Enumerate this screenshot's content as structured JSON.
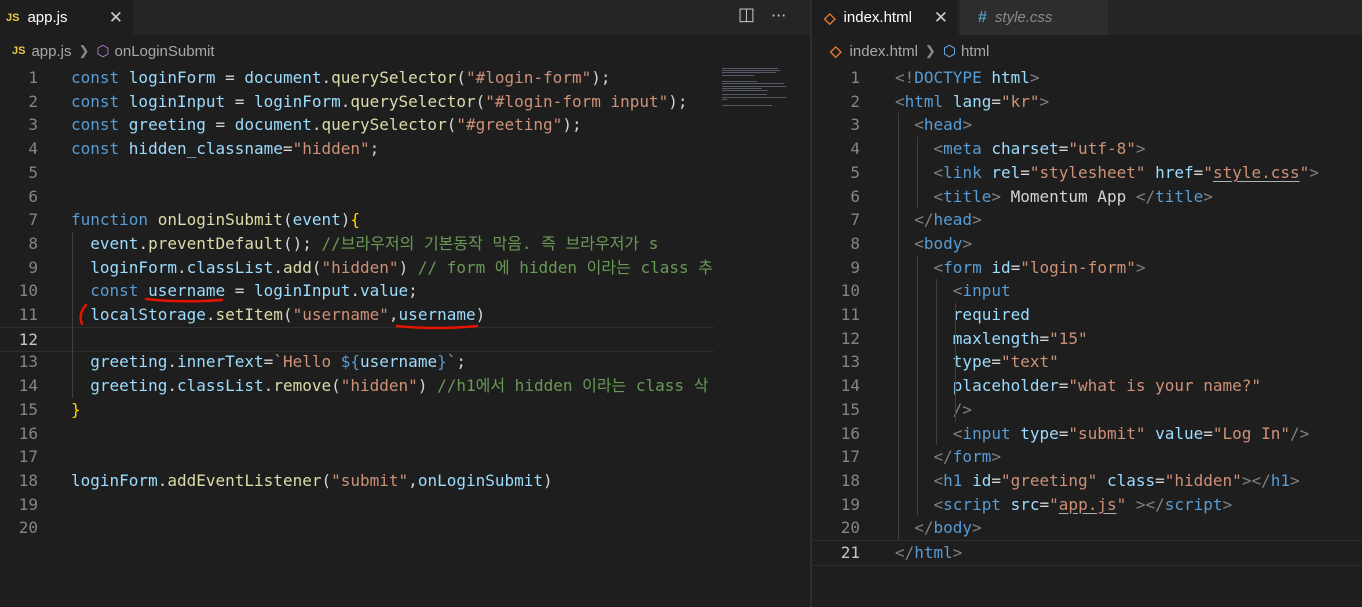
{
  "left": {
    "tab": {
      "icon": "JS",
      "label": "app.js",
      "close": "✕"
    },
    "actions": {
      "split": "◫",
      "more": "···"
    },
    "breadcrumb": {
      "file": "app.js",
      "symbol": "onLoginSubmit"
    },
    "lines": [
      {
        "n": "1",
        "t": [
          [
            "k",
            "const "
          ],
          [
            "v",
            "loginForm"
          ],
          [
            "p",
            " = "
          ],
          [
            "v",
            "document"
          ],
          [
            "p",
            "."
          ],
          [
            "f",
            "querySelector"
          ],
          [
            "p",
            "("
          ],
          [
            "s",
            "\"#login-form\""
          ],
          [
            "p",
            ");"
          ]
        ]
      },
      {
        "n": "2",
        "t": [
          [
            "k",
            "const "
          ],
          [
            "v",
            "loginInput"
          ],
          [
            "p",
            " = "
          ],
          [
            "v",
            "loginForm"
          ],
          [
            "p",
            "."
          ],
          [
            "f",
            "querySelector"
          ],
          [
            "p",
            "("
          ],
          [
            "s",
            "\"#login-form input\""
          ],
          [
            "p",
            ");"
          ]
        ]
      },
      {
        "n": "3",
        "t": [
          [
            "k",
            "const "
          ],
          [
            "v",
            "greeting"
          ],
          [
            "p",
            " = "
          ],
          [
            "v",
            "document"
          ],
          [
            "p",
            "."
          ],
          [
            "f",
            "querySelector"
          ],
          [
            "p",
            "("
          ],
          [
            "s",
            "\"#greeting\""
          ],
          [
            "p",
            ");"
          ]
        ]
      },
      {
        "n": "4",
        "t": [
          [
            "k",
            "const "
          ],
          [
            "v",
            "hidden_classname"
          ],
          [
            "p",
            "="
          ],
          [
            "s",
            "\"hidden\""
          ],
          [
            "p",
            ";"
          ]
        ]
      },
      {
        "n": "5",
        "t": []
      },
      {
        "n": "6",
        "t": []
      },
      {
        "n": "7",
        "t": [
          [
            "k",
            "function "
          ],
          [
            "f",
            "onLoginSubmit"
          ],
          [
            "p",
            "("
          ],
          [
            "v",
            "event"
          ],
          [
            "p",
            ")"
          ],
          [
            "b",
            "{"
          ]
        ]
      },
      {
        "n": "8",
        "t": [
          [
            "p",
            "  "
          ],
          [
            "v",
            "event"
          ],
          [
            "p",
            "."
          ],
          [
            "f",
            "preventDefault"
          ],
          [
            "p",
            "(); "
          ],
          [
            "c",
            "//브라우저의 기본동작 막음. 즉 브라우저가 s"
          ]
        ]
      },
      {
        "n": "9",
        "t": [
          [
            "p",
            "  "
          ],
          [
            "v",
            "loginForm"
          ],
          [
            "p",
            "."
          ],
          [
            "v",
            "classList"
          ],
          [
            "p",
            "."
          ],
          [
            "f",
            "add"
          ],
          [
            "p",
            "("
          ],
          [
            "s",
            "\"hidden\""
          ],
          [
            "p",
            ") "
          ],
          [
            "c",
            "// form 에 hidden 이라는 class 추"
          ]
        ]
      },
      {
        "n": "10",
        "t": [
          [
            "p",
            "  "
          ],
          [
            "k",
            "const "
          ],
          [
            "v",
            "username"
          ],
          [
            "p",
            " = "
          ],
          [
            "v",
            "loginInput"
          ],
          [
            "p",
            "."
          ],
          [
            "v",
            "value"
          ],
          [
            "p",
            ";"
          ]
        ]
      },
      {
        "n": "11",
        "t": [
          [
            "p",
            "  "
          ],
          [
            "v",
            "localStorage"
          ],
          [
            "p",
            "."
          ],
          [
            "f",
            "setItem"
          ],
          [
            "p",
            "("
          ],
          [
            "s",
            "\"username\""
          ],
          [
            "p",
            ","
          ],
          [
            "v",
            "username"
          ],
          [
            "p",
            ")"
          ]
        ]
      },
      {
        "n": "12",
        "t": []
      },
      {
        "n": "13",
        "t": [
          [
            "p",
            "  "
          ],
          [
            "v",
            "greeting"
          ],
          [
            "p",
            "."
          ],
          [
            "v",
            "innerText"
          ],
          [
            "p",
            "="
          ],
          [
            "s",
            "`Hello "
          ],
          [
            "k",
            "${"
          ],
          [
            "v",
            "username"
          ],
          [
            "k",
            "}"
          ],
          [
            "s",
            "`"
          ],
          [
            "p",
            ";"
          ]
        ]
      },
      {
        "n": "14",
        "t": [
          [
            "p",
            "  "
          ],
          [
            "v",
            "greeting"
          ],
          [
            "p",
            "."
          ],
          [
            "v",
            "classList"
          ],
          [
            "p",
            "."
          ],
          [
            "f",
            "remove"
          ],
          [
            "p",
            "("
          ],
          [
            "s",
            "\"hidden\""
          ],
          [
            "p",
            ") "
          ],
          [
            "c",
            "//h1에서 hidden 이라는 class 삭"
          ]
        ]
      },
      {
        "n": "15",
        "t": [
          [
            "b",
            "}"
          ]
        ]
      },
      {
        "n": "16",
        "t": []
      },
      {
        "n": "17",
        "t": []
      },
      {
        "n": "18",
        "t": [
          [
            "v",
            "loginForm"
          ],
          [
            "p",
            "."
          ],
          [
            "f",
            "addEventListener"
          ],
          [
            "p",
            "("
          ],
          [
            "s",
            "\"submit\""
          ],
          [
            "p",
            ","
          ],
          [
            "v",
            "onLoginSubmit"
          ],
          [
            "p",
            ")"
          ]
        ]
      },
      {
        "n": "19",
        "t": []
      },
      {
        "n": "20",
        "t": []
      }
    ]
  },
  "right": {
    "tabs": [
      {
        "icon": "◇",
        "label": "index.html",
        "close": "✕"
      },
      {
        "icon": "#",
        "label": "style.css"
      }
    ],
    "breadcrumb": {
      "file": "index.html",
      "symbol": "html"
    },
    "lines": [
      {
        "n": "1",
        "t": [
          [
            "g",
            "<!"
          ],
          [
            "t",
            "DOCTYPE "
          ],
          [
            "a",
            "html"
          ],
          [
            "g",
            ">"
          ]
        ]
      },
      {
        "n": "2",
        "t": [
          [
            "g",
            "<"
          ],
          [
            "t",
            "html "
          ],
          [
            "a",
            "lang"
          ],
          [
            "p",
            "="
          ],
          [
            "s",
            "\"kr\""
          ],
          [
            "g",
            ">"
          ]
        ]
      },
      {
        "n": "3",
        "t": [
          [
            "p",
            "  "
          ],
          [
            "g",
            "<"
          ],
          [
            "t",
            "head"
          ],
          [
            "g",
            ">"
          ]
        ]
      },
      {
        "n": "4",
        "t": [
          [
            "p",
            "    "
          ],
          [
            "g",
            "<"
          ],
          [
            "t",
            "meta "
          ],
          [
            "a",
            "charset"
          ],
          [
            "p",
            "="
          ],
          [
            "s",
            "\"utf-8\""
          ],
          [
            "g",
            ">"
          ]
        ]
      },
      {
        "n": "5",
        "t": [
          [
            "p",
            "    "
          ],
          [
            "g",
            "<"
          ],
          [
            "t",
            "link "
          ],
          [
            "a",
            "rel"
          ],
          [
            "p",
            "="
          ],
          [
            "s",
            "\"stylesheet\""
          ],
          [
            "a",
            " href"
          ],
          [
            "p",
            "="
          ],
          [
            "s",
            "\""
          ],
          [
            "su",
            "style.css"
          ],
          [
            "s",
            "\""
          ],
          [
            "g",
            ">"
          ]
        ]
      },
      {
        "n": "6",
        "t": [
          [
            "p",
            "    "
          ],
          [
            "g",
            "<"
          ],
          [
            "t",
            "title"
          ],
          [
            "g",
            "> "
          ],
          [
            "p",
            "Momentum App "
          ],
          [
            "g",
            "</"
          ],
          [
            "t",
            "title"
          ],
          [
            "g",
            ">"
          ]
        ]
      },
      {
        "n": "7",
        "t": [
          [
            "p",
            "  "
          ],
          [
            "g",
            "</"
          ],
          [
            "t",
            "head"
          ],
          [
            "g",
            ">"
          ]
        ]
      },
      {
        "n": "8",
        "t": [
          [
            "p",
            "  "
          ],
          [
            "g",
            "<"
          ],
          [
            "t",
            "body"
          ],
          [
            "g",
            ">"
          ]
        ]
      },
      {
        "n": "9",
        "t": [
          [
            "p",
            "    "
          ],
          [
            "g",
            "<"
          ],
          [
            "t",
            "form "
          ],
          [
            "a",
            "id"
          ],
          [
            "p",
            "="
          ],
          [
            "s",
            "\"login-form\""
          ],
          [
            "g",
            ">"
          ]
        ]
      },
      {
        "n": "10",
        "t": [
          [
            "p",
            "      "
          ],
          [
            "g",
            "<"
          ],
          [
            "t",
            "input"
          ]
        ]
      },
      {
        "n": "11",
        "t": [
          [
            "p",
            "      "
          ],
          [
            "a",
            "required"
          ]
        ]
      },
      {
        "n": "12",
        "t": [
          [
            "p",
            "      "
          ],
          [
            "a",
            "maxlength"
          ],
          [
            "p",
            "="
          ],
          [
            "s",
            "\"15\""
          ]
        ]
      },
      {
        "n": "13",
        "t": [
          [
            "p",
            "      "
          ],
          [
            "a",
            "type"
          ],
          [
            "p",
            "="
          ],
          [
            "s",
            "\"text\""
          ]
        ]
      },
      {
        "n": "14",
        "t": [
          [
            "p",
            "      "
          ],
          [
            "a",
            "placeholder"
          ],
          [
            "p",
            "="
          ],
          [
            "s",
            "\"what is your name?\""
          ]
        ]
      },
      {
        "n": "15",
        "t": [
          [
            "p",
            "      "
          ],
          [
            "g",
            "/>"
          ]
        ]
      },
      {
        "n": "16",
        "t": [
          [
            "p",
            "      "
          ],
          [
            "g",
            "<"
          ],
          [
            "t",
            "input "
          ],
          [
            "a",
            "type"
          ],
          [
            "p",
            "="
          ],
          [
            "s",
            "\"submit\""
          ],
          [
            "a",
            " value"
          ],
          [
            "p",
            "="
          ],
          [
            "s",
            "\"Log In\""
          ],
          [
            "g",
            "/>"
          ]
        ]
      },
      {
        "n": "17",
        "t": [
          [
            "p",
            "    "
          ],
          [
            "g",
            "</"
          ],
          [
            "t",
            "form"
          ],
          [
            "g",
            ">"
          ]
        ]
      },
      {
        "n": "18",
        "t": [
          [
            "p",
            "    "
          ],
          [
            "g",
            "<"
          ],
          [
            "t",
            "h1 "
          ],
          [
            "a",
            "id"
          ],
          [
            "p",
            "="
          ],
          [
            "s",
            "\"greeting\""
          ],
          [
            "a",
            " class"
          ],
          [
            "p",
            "="
          ],
          [
            "s",
            "\"hidden\""
          ],
          [
            "g",
            "></"
          ],
          [
            "t",
            "h1"
          ],
          [
            "g",
            ">"
          ]
        ]
      },
      {
        "n": "19",
        "t": [
          [
            "p",
            "    "
          ],
          [
            "g",
            "<"
          ],
          [
            "t",
            "script "
          ],
          [
            "a",
            "src"
          ],
          [
            "p",
            "="
          ],
          [
            "s",
            "\""
          ],
          [
            "su",
            "app.js"
          ],
          [
            "s",
            "\""
          ],
          [
            "g",
            " ></"
          ],
          [
            "t",
            "script"
          ],
          [
            "g",
            ">"
          ]
        ]
      },
      {
        "n": "20",
        "t": [
          [
            "p",
            "  "
          ],
          [
            "g",
            "</"
          ],
          [
            "t",
            "body"
          ],
          [
            "g",
            ">"
          ]
        ]
      },
      {
        "n": "21",
        "t": [
          [
            "g",
            "</"
          ],
          [
            "t",
            "html"
          ],
          [
            "g",
            ">"
          ]
        ]
      }
    ]
  },
  "colors": {
    "background": "#1e1e1e",
    "keyword": "#569cd6",
    "variable": "#9cdcfe",
    "function": "#dcdcaa",
    "string": "#ce9178",
    "comment": "#6a9955",
    "annotation": "#e51400"
  }
}
